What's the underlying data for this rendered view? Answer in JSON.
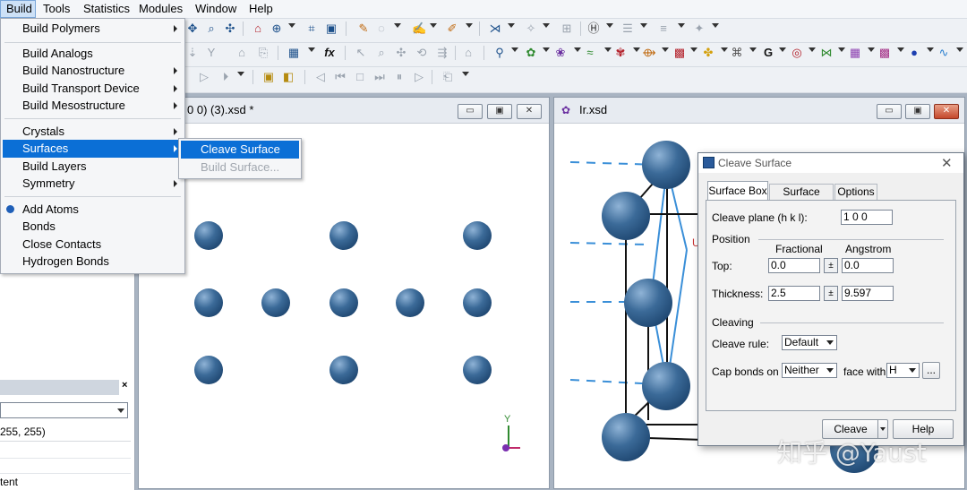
{
  "menubar": {
    "items": [
      "Build",
      "Tools",
      "Statistics",
      "Modules",
      "Window",
      "Help"
    ],
    "active": "Build"
  },
  "build_menu": {
    "items": [
      {
        "label": "Build Polymers",
        "submenu": true
      },
      {
        "label": "Build Analogs",
        "submenu": false
      },
      {
        "label": "Build Nanostructure",
        "submenu": true
      },
      {
        "label": "Build Transport Device",
        "submenu": true
      },
      {
        "label": "Build Mesostructure",
        "submenu": true
      },
      {
        "label": "Crystals",
        "submenu": true
      },
      {
        "label": "Surfaces",
        "submenu": true,
        "selected": true
      },
      {
        "label": "Build Layers",
        "submenu": false
      },
      {
        "label": "Symmetry",
        "submenu": true
      },
      {
        "label": "Add Atoms",
        "submenu": false
      },
      {
        "label": "Bonds",
        "submenu": false
      },
      {
        "label": "Close Contacts",
        "submenu": false
      },
      {
        "label": "Hydrogen Bonds",
        "submenu": false
      }
    ]
  },
  "surfaces_submenu": {
    "items": [
      {
        "label": "Cleave Surface",
        "selected": true
      },
      {
        "label": "Build Surface...",
        "disabled": true
      }
    ]
  },
  "left_panel": {
    "color_value": "255, 255)",
    "row_text": "tent"
  },
  "doc_left": {
    "title": "0 0) (3).xsd *",
    "axis_label": "Y"
  },
  "doc_right": {
    "title": "Ir.xsd"
  },
  "dialog": {
    "title": "Cleave Surface",
    "tabs": [
      "Surface Box",
      "Surface Mesh",
      "Options"
    ],
    "active_tab": "Surface Box",
    "cleave_plane_label": "Cleave plane (h k l):",
    "cleave_plane_value": "1 0 0",
    "position_label": "Position",
    "fractional_label": "Fractional",
    "angstrom_label": "Angstrom",
    "top_label": "Top:",
    "top_fractional": "0.0",
    "top_angstrom": "0.0",
    "thickness_label": "Thickness:",
    "thickness_fractional": "2.5",
    "thickness_angstrom": "9.597",
    "cleaving_label": "Cleaving",
    "cleave_rule_label": "Cleave rule:",
    "cleave_rule_value": "Default",
    "cap_bonds_label": "Cap bonds on",
    "cap_bonds_value": "Neither",
    "face_with_label": "face with",
    "face_with_value": "H",
    "ellipsis_label": "...",
    "cleave_button": "Cleave",
    "help_button": "Help"
  },
  "watermark": "知乎 @Yaust",
  "colors": {
    "accent": "#0b6fd6",
    "atom": "#2a5a8a",
    "dashed_line": "#3a8fd8"
  }
}
